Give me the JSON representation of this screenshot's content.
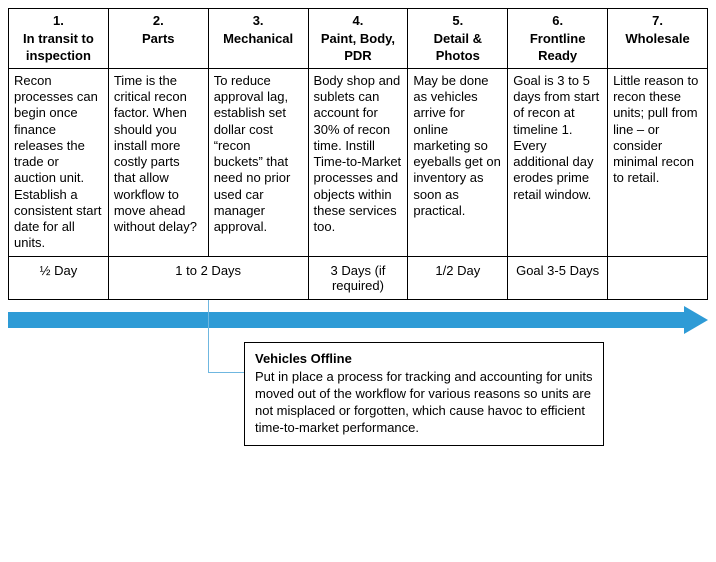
{
  "columns": [
    {
      "num": "1.",
      "title": "In transit to inspection"
    },
    {
      "num": "2.",
      "title": "Parts"
    },
    {
      "num": "3.",
      "title": "Mechanical"
    },
    {
      "num": "4.",
      "title": "Paint, Body, PDR"
    },
    {
      "num": "5.",
      "title": "Detail & Photos"
    },
    {
      "num": "6.",
      "title": "Frontline Ready"
    },
    {
      "num": "7.",
      "title": "Wholesale"
    }
  ],
  "descriptions": [
    "Recon processes can begin once finance releases the trade or auction unit. Establish a consistent start date for all units.",
    "Time is the critical recon factor. When should you install more costly parts that allow workflow to move ahead without delay?",
    "To reduce approval lag, establish set dollar cost “recon buckets” that need no prior used car manager approval.",
    "Body shop and sublets can account for 30% of recon time. Instill Time-to-Market processes and objects within these services too.",
    "May be done as vehicles arrive for online marketing so eyeballs get on inventory as soon as practical.",
    "Goal is 3 to 5 days from start of recon at timeline 1. Every additional day erodes prime retail window.",
    "Little reason to recon these units; pull from line – or consider minimal recon to retail."
  ],
  "durations": {
    "col1": "½ Day",
    "col2_3": "1 to 2 Days",
    "col4": "3 Days (if required)",
    "col5": "1/2 Day",
    "col6": "Goal 3-5 Days",
    "col7": ""
  },
  "callout": {
    "title": "Vehicles Offline",
    "body": "Put in place a process for tracking and accounting for units moved out of the workflow for various reasons so units are not misplaced or forgotten, which cause havoc to efficient time-to-market performance."
  }
}
